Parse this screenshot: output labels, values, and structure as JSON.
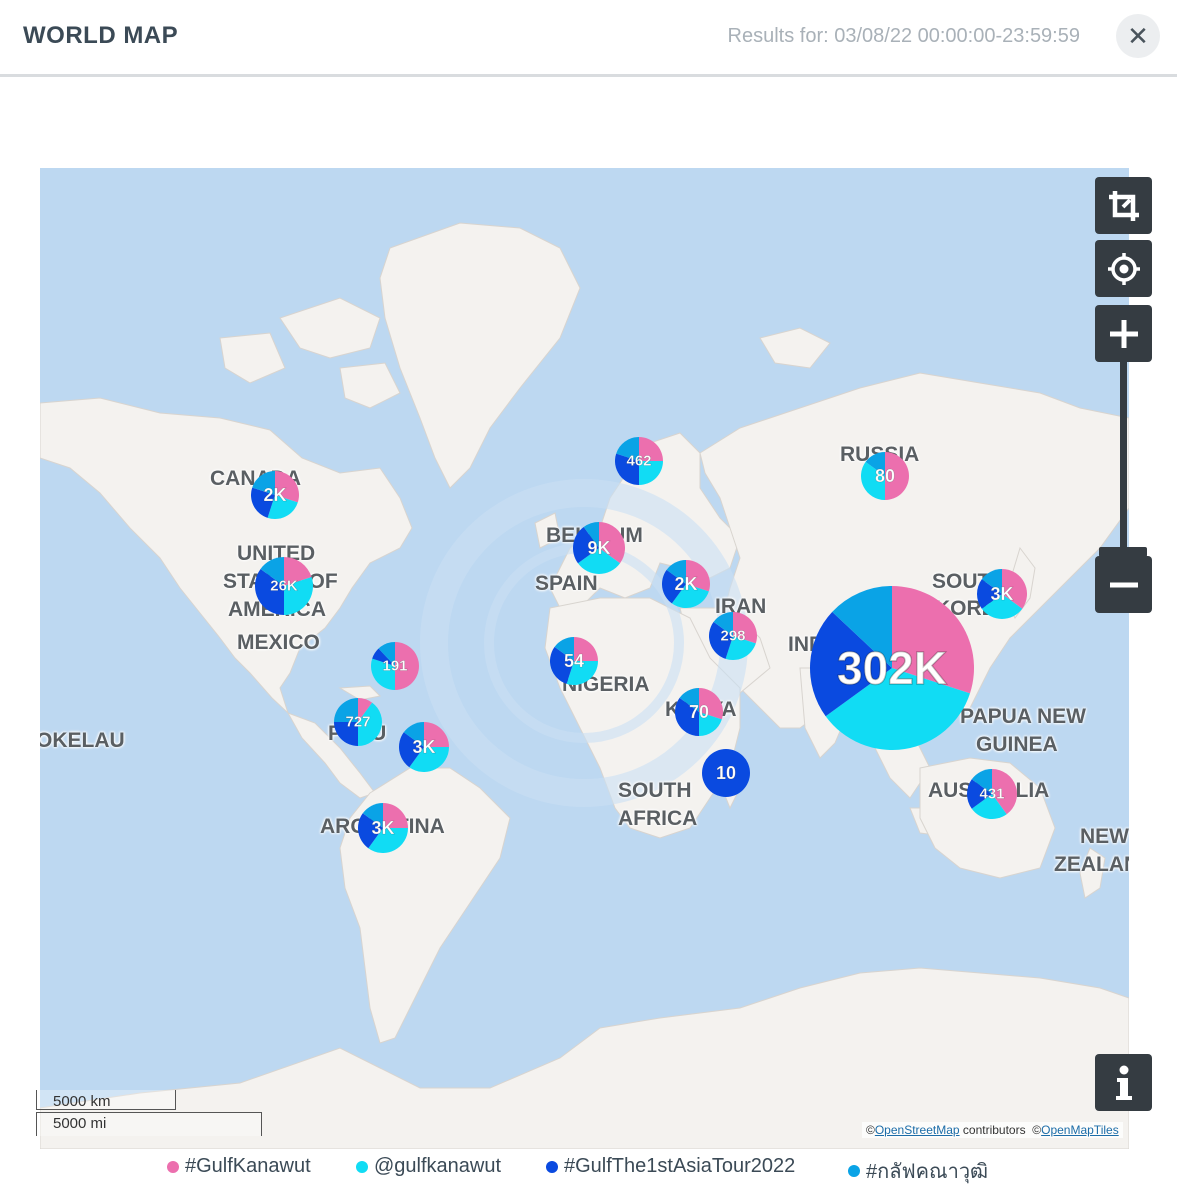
{
  "header": {
    "title": "WORLD MAP",
    "results": "Results for: 03/08/22 00:00:00-23:59:59",
    "close_icon": "close-icon"
  },
  "colors": {
    "gulfkanawut_hashtag": "#ec6fae",
    "gulfkanawut_mention": "#11dcf4",
    "asiatour": "#0a4ae0",
    "thai_hashtag": "#0aa3e6",
    "ocean": "#bdd8f1",
    "land": "#f4f2ef",
    "control": "#353c42"
  },
  "country_labels": [
    "CANADA",
    "UNITED",
    "STATES OF",
    "AMERICA",
    "MEXICO",
    "OKELAU",
    "BELGIUM",
    "SPAIN",
    "NIGERIA",
    "IRAN",
    "RUSSIA",
    "SOUTH",
    "KOREA",
    "INDIA",
    "KENYA",
    "SOUTH",
    "AFRICA",
    "PAPUA NEW",
    "GUINEA",
    "AUSTRALIA",
    "ARGENTINA",
    "PERU",
    "NEW",
    "ZEALAND"
  ],
  "clusters": [
    {
      "id": "canada",
      "label": "2K",
      "shares": [
        0.3,
        0.25,
        0.25,
        0.2
      ]
    },
    {
      "id": "usa",
      "label": "26K",
      "shares": [
        0.2,
        0.3,
        0.35,
        0.15
      ]
    },
    {
      "id": "colombia",
      "label": "191",
      "shares": [
        0.5,
        0.3,
        0.08,
        0.12
      ]
    },
    {
      "id": "peru",
      "label": "727",
      "shares": [
        0.1,
        0.4,
        0.25,
        0.25
      ]
    },
    {
      "id": "brazil",
      "label": "3K",
      "shares": [
        0.25,
        0.35,
        0.25,
        0.15
      ]
    },
    {
      "id": "argentina",
      "label": "3K",
      "shares": [
        0.25,
        0.35,
        0.25,
        0.15
      ]
    },
    {
      "id": "finland",
      "label": "462",
      "shares": [
        0.25,
        0.25,
        0.3,
        0.2
      ]
    },
    {
      "id": "belgium",
      "label": "9K",
      "shares": [
        0.35,
        0.3,
        0.25,
        0.1
      ]
    },
    {
      "id": "turkey",
      "label": "2K",
      "shares": [
        0.3,
        0.3,
        0.25,
        0.15
      ]
    },
    {
      "id": "nigeria",
      "label": "54",
      "shares": [
        0.25,
        0.3,
        0.3,
        0.15
      ]
    },
    {
      "id": "iran",
      "label": "298",
      "shares": [
        0.3,
        0.25,
        0.3,
        0.15
      ]
    },
    {
      "id": "kenya",
      "label": "70",
      "shares": [
        0.3,
        0.2,
        0.35,
        0.15
      ]
    },
    {
      "id": "madagascar",
      "label": "10",
      "shares": [
        0,
        0,
        1,
        0
      ]
    },
    {
      "id": "russia",
      "label": "80",
      "shares": [
        0.5,
        0.35,
        0,
        0.15
      ]
    },
    {
      "id": "korea",
      "label": "3K",
      "shares": [
        0.35,
        0.3,
        0.2,
        0.15
      ]
    },
    {
      "id": "india",
      "label": "302K",
      "shares": [
        0.3,
        0.35,
        0.22,
        0.13
      ]
    },
    {
      "id": "australia",
      "label": "431",
      "shares": [
        0.4,
        0.25,
        0.2,
        0.15
      ]
    }
  ],
  "controls": {
    "crop_icon": "crop-icon",
    "locate_icon": "crosshair-icon",
    "zoom_in": "+",
    "zoom_out": "−",
    "info": "i"
  },
  "scale": {
    "km": "5000 km",
    "mi": "5000 mi"
  },
  "attribution": {
    "prefix": "©",
    "osm": "OpenStreetMap",
    "contributors": " contributors",
    "prefix2": "©",
    "omt": "OpenMapTiles"
  },
  "legend": [
    {
      "label": "#GulfKanawut",
      "color": "#ec6fae"
    },
    {
      "label": "@gulfkanawut",
      "color": "#11dcf4"
    },
    {
      "label": "#GulfThe1stAsiaTour2022",
      "color": "#0a4ae0"
    },
    {
      "label": "#กลัฟคณาวุฒิ",
      "color": "#0aa3e6"
    }
  ]
}
